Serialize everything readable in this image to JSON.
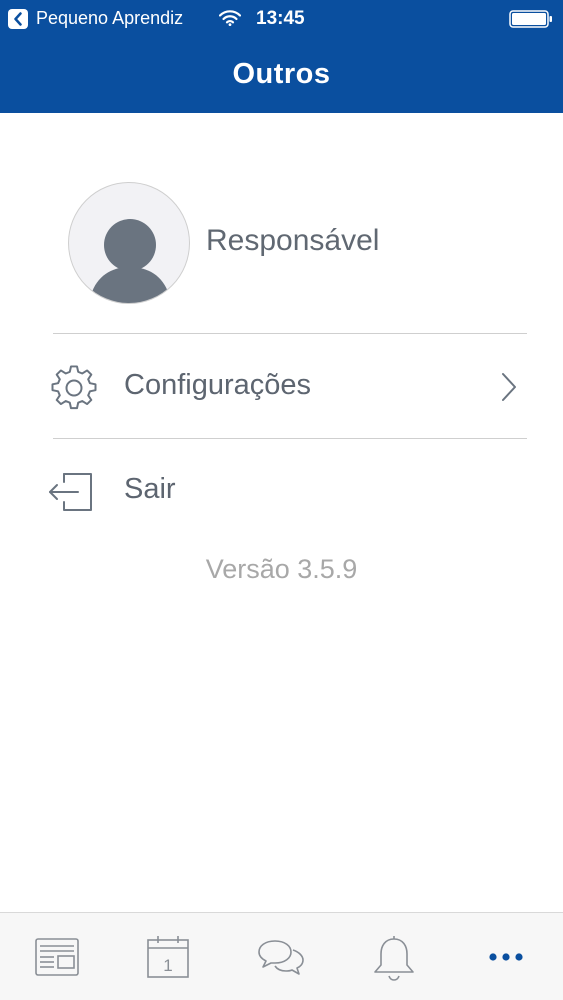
{
  "status_bar": {
    "back_app_label": "Pequeno Aprendiz",
    "time": "13:45"
  },
  "header": {
    "title": "Outros"
  },
  "profile": {
    "name": "Responsável"
  },
  "menu": {
    "settings_label": "Configurações",
    "logout_label": "Sair"
  },
  "version_text": "Versão 3.5.9",
  "tab_bar": {
    "tabs": [
      {
        "icon": "news-icon",
        "active": false
      },
      {
        "icon": "calendar-icon",
        "day": "1",
        "active": false
      },
      {
        "icon": "chat-icon",
        "active": false
      },
      {
        "icon": "bell-icon",
        "active": false
      },
      {
        "icon": "more-icon",
        "active": true
      }
    ]
  },
  "colors": {
    "header_bg": "#0a4f9f",
    "active_tab": "#0a4f9f",
    "inactive_tab": "#8a8f96",
    "text": "#5d6570"
  }
}
